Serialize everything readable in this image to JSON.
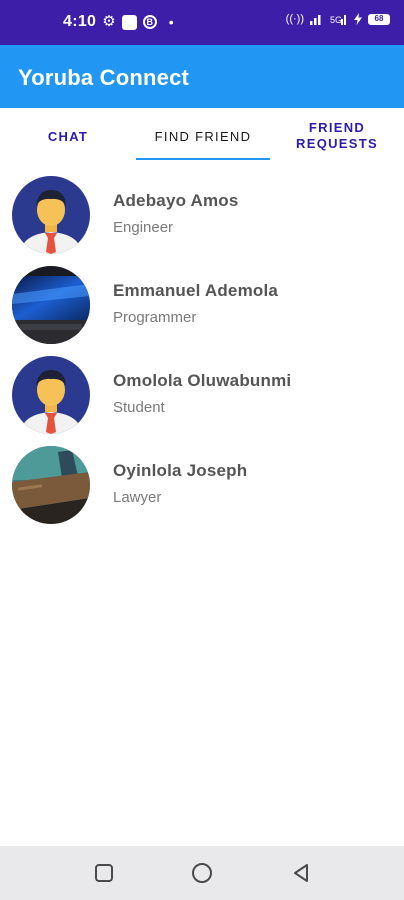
{
  "status_bar": {
    "time": "4:10",
    "badge_letter": "B",
    "dot": "•",
    "signal_text": "((·))",
    "network_text": "ıl",
    "battery": "68"
  },
  "app": {
    "title": "Yoruba Connect"
  },
  "tabs": [
    {
      "label": "CHAT",
      "active": false
    },
    {
      "label": "FIND FRIEND",
      "active": true
    },
    {
      "label": "FRIEND REQUESTS",
      "active": false
    }
  ],
  "friends": [
    {
      "name": "Adebayo Amos",
      "role": "Engineer",
      "avatar": "default-avatar"
    },
    {
      "name": "Emmanuel Ademola",
      "role": "Programmer",
      "avatar": "desktop-photo"
    },
    {
      "name": "Omolola Oluwabunmi",
      "role": "Student",
      "avatar": "default-avatar"
    },
    {
      "name": "Oyinlola Joseph",
      "role": "Lawyer",
      "avatar": "room-photo"
    }
  ],
  "colors": {
    "status_bar": "#3c1ea8",
    "app_bar": "#2196f3",
    "tab_text": "#2c1ca6",
    "indicator": "#2196f3"
  }
}
